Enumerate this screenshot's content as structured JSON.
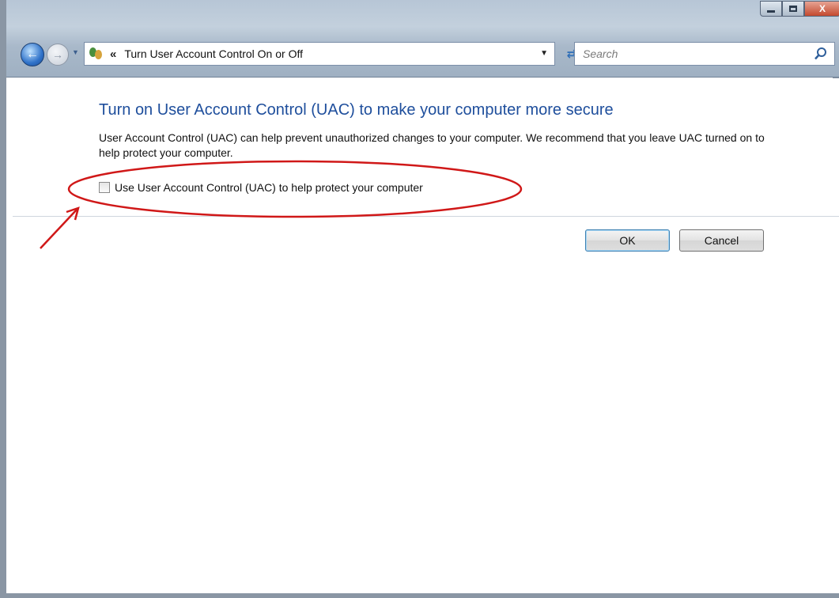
{
  "window": {
    "caption_buttons": {
      "minimize": "minimize",
      "maximize": "maximize",
      "close": "X"
    }
  },
  "navigation": {
    "breadcrumb_separator": "«",
    "address_text": "Turn User Account Control On or Off",
    "search_placeholder": "Search"
  },
  "content": {
    "heading": "Turn on User Account Control (UAC) to make your computer more secure",
    "description": "User Account Control (UAC) can help prevent unauthorized changes to your computer.  We recommend that you leave UAC turned on to help protect your computer.",
    "checkbox_label": "Use User Account Control (UAC) to help protect your computer",
    "checkbox_checked": false
  },
  "buttons": {
    "ok": "OK",
    "cancel": "Cancel"
  },
  "colors": {
    "heading": "#1e4e9c",
    "annotation": "#d01818",
    "frame": "#b7c6d6"
  },
  "icons": {
    "back": "arrow-left-icon",
    "forward": "arrow-right-icon",
    "address": "users-icon",
    "refresh": "refresh-icon",
    "search": "search-icon"
  }
}
